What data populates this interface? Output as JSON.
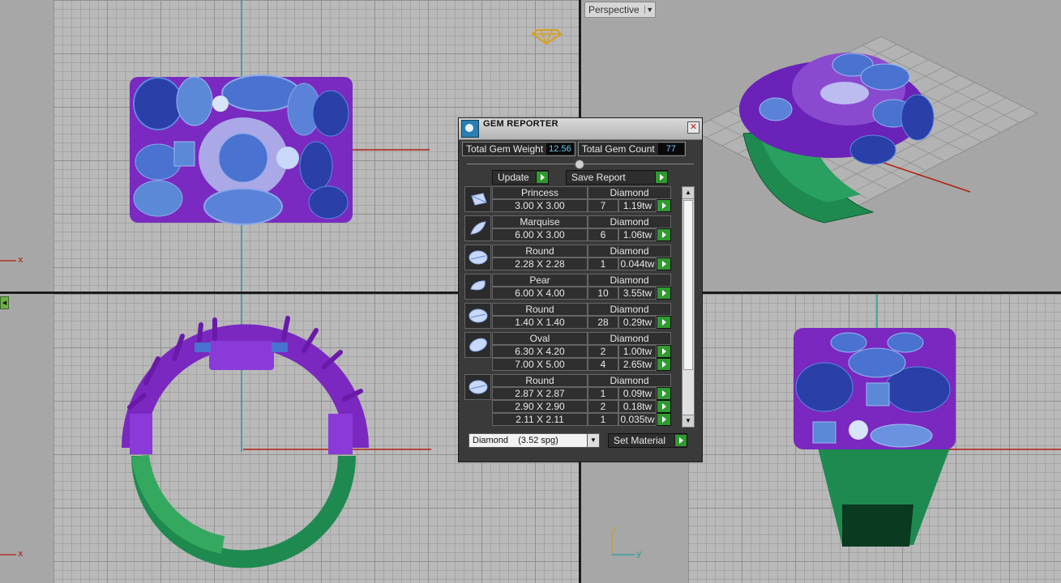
{
  "viewports": {
    "perspective_label": "Perspective",
    "axis_x_top": "x",
    "axis_x_front": "x",
    "axis_z_left": "z",
    "axis_y_left": "y"
  },
  "gem_reporter": {
    "title": "GEM REPORTER",
    "total_weight_label": "Total Gem Weight",
    "total_weight_value": "12.56",
    "total_count_label": "Total Gem Count",
    "total_count_value": "77",
    "update_label": "Update",
    "save_report_label": "Save Report",
    "material_value": "Diamond    (3.52 spg)",
    "set_material_label": "Set Material",
    "groups": [
      {
        "shape": "Princess",
        "material": "Diamond",
        "icon": "princess-gem-icon",
        "rows": [
          {
            "size": "3.00 X 3.00",
            "count": "7",
            "weight": "1.19tw"
          }
        ]
      },
      {
        "shape": "Marquise",
        "material": "Diamond",
        "icon": "marquise-gem-icon",
        "rows": [
          {
            "size": "6.00 X 3.00",
            "count": "6",
            "weight": "1.06tw"
          }
        ]
      },
      {
        "shape": "Round",
        "material": "Diamond",
        "icon": "round-gem-icon",
        "rows": [
          {
            "size": "2.28 X 2.28",
            "count": "1",
            "weight": "0.044tw"
          }
        ]
      },
      {
        "shape": "Pear",
        "material": "Diamond",
        "icon": "pear-gem-icon",
        "rows": [
          {
            "size": "6.00 X 4.00",
            "count": "10",
            "weight": "3.55tw"
          }
        ]
      },
      {
        "shape": "Round",
        "material": "Diamond",
        "icon": "round-gem-icon",
        "rows": [
          {
            "size": "1.40 X 1.40",
            "count": "28",
            "weight": "0.29tw"
          }
        ]
      },
      {
        "shape": "Oval",
        "material": "Diamond",
        "icon": "oval-gem-icon",
        "rows": [
          {
            "size": "6.30 X 4.20",
            "count": "2",
            "weight": "1.00tw"
          },
          {
            "size": "7.00 X 5.00",
            "count": "4",
            "weight": "2.65tw"
          }
        ]
      },
      {
        "shape": "Round",
        "material": "Diamond",
        "icon": "round-gem-icon",
        "rows": [
          {
            "size": "2.87 X 2.87",
            "count": "1",
            "weight": "0.09tw"
          },
          {
            "size": "2.90 X 2.90",
            "count": "2",
            "weight": "0.18tw"
          },
          {
            "size": "2.11 X 2.11",
            "count": "1",
            "weight": "0.035tw"
          }
        ]
      }
    ]
  }
}
